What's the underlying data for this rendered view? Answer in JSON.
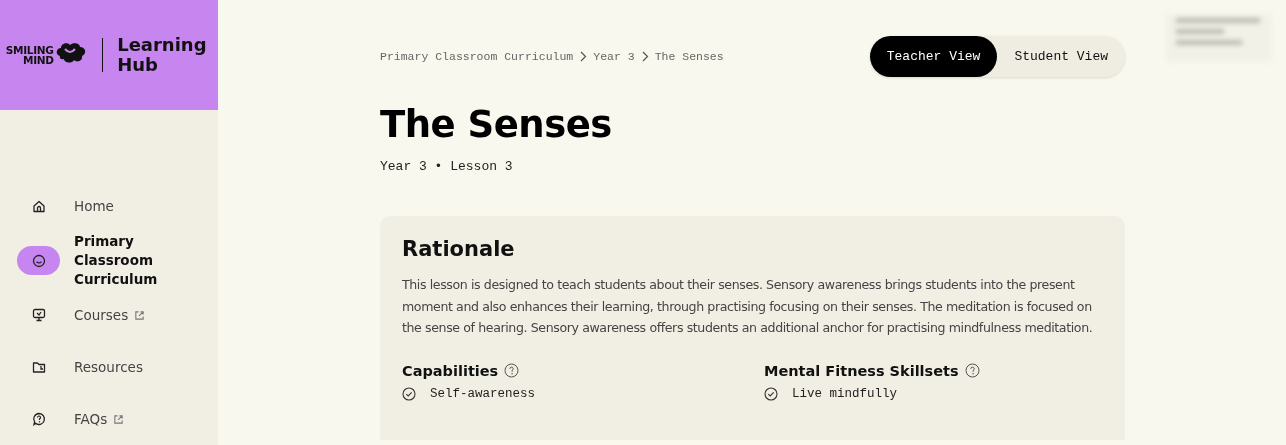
{
  "sidebar": {
    "logo": {
      "brand_lines": [
        "SMILING",
        "MIND"
      ],
      "title": "Learning Hub"
    },
    "items": [
      {
        "label": "Home",
        "selected": false,
        "external": false
      },
      {
        "label": "Primary Classroom Curriculum",
        "selected": true,
        "external": false
      },
      {
        "label": "Courses",
        "selected": false,
        "external": true
      },
      {
        "label": "Resources",
        "selected": false,
        "external": false
      },
      {
        "label": "FAQs",
        "selected": false,
        "external": true
      }
    ]
  },
  "breadcrumb": [
    "Primary Classroom Curriculum",
    "Year 3",
    "The Senses"
  ],
  "view_toggle": [
    {
      "label": "Teacher View",
      "selected": true
    },
    {
      "label": "Student View",
      "selected": false
    }
  ],
  "title": "The Senses",
  "subtitle": "Year 3 • Lesson 3",
  "card": {
    "heading": "Rationale",
    "text": "This lesson is designed to teach students about their senses. Sensory awareness brings students into the present moment and also enhances their learning, through practising focusing on their senses. The meditation is focused on the sense of hearing. Sensory awareness offers students an additional anchor for practising mindfulness meditation.",
    "sections": [
      {
        "heading": "Capabilities",
        "items": [
          "Self-awareness"
        ]
      },
      {
        "heading": "Mental Fitness Skillsets",
        "items": [
          "Live mindfully"
        ]
      }
    ]
  }
}
